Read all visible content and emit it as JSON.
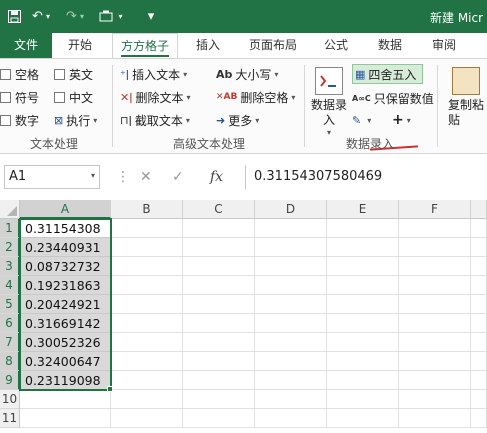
{
  "window": {
    "title": "新建 Micr"
  },
  "quick_access": {
    "save_icon": "save-icon",
    "undo_icon": "undo-icon",
    "redo_icon": "redo-icon",
    "customize_icon": "customize-icon"
  },
  "tabs": [
    {
      "label": "文件"
    },
    {
      "label": "开始"
    },
    {
      "label": "方方格子"
    },
    {
      "label": "插入"
    },
    {
      "label": "页面布局"
    },
    {
      "label": "公式"
    },
    {
      "label": "数据"
    },
    {
      "label": "审阅"
    }
  ],
  "ribbon": {
    "text_processing": {
      "label": "文本处理",
      "checkboxes": [
        "空格",
        "英文",
        "符号",
        "中文",
        "数字"
      ],
      "execute": "执行"
    },
    "advanced_text": {
      "label": "高级文本处理",
      "insert_text": "插入文本",
      "delete_text": "删除文本",
      "extract_text": "截取文本",
      "case": "大小写",
      "delete_spaces": "删除空格",
      "more": "更多"
    },
    "data_entry": {
      "label": "数据录入",
      "data_entry_button": "数据录入",
      "round": "四舍五入",
      "keep_value": "只保留数值"
    },
    "copy_paste": {
      "label": "复制粘贴"
    }
  },
  "formula_bar": {
    "name_box": "A1",
    "fx_label": "fx",
    "formula": "0.31154307580469"
  },
  "grid": {
    "columns": [
      "A",
      "B",
      "C",
      "D",
      "E",
      "F"
    ],
    "rows": [
      "1",
      "2",
      "3",
      "4",
      "5",
      "6",
      "7",
      "8",
      "9",
      "10",
      "11"
    ],
    "column_a_values": [
      "0.31154308",
      "0.23440931",
      "0.08732732",
      "0.19231863",
      "0.20424921",
      "0.31669142",
      "0.30052326",
      "0.32400647",
      "0.23119098"
    ]
  },
  "colors": {
    "accent": "#217346",
    "selection_fill": "#d9d9d9",
    "annotation_red": "#d03030"
  }
}
